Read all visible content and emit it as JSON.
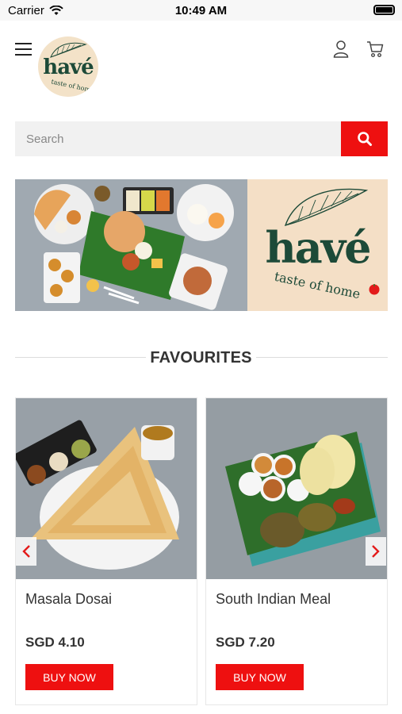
{
  "status_bar": {
    "carrier": "Carrier",
    "time": "10:49 AM"
  },
  "header": {
    "logo_text": "havé",
    "logo_tagline": "taste of home"
  },
  "search": {
    "placeholder": "Search"
  },
  "banner": {
    "brand_text": "havé",
    "tagline": "taste of home"
  },
  "favourites": {
    "title": "FAVOURITES",
    "products": [
      {
        "name": "Masala Dosai",
        "price": "SGD 4.10",
        "button_label": "BUY NOW"
      },
      {
        "name": "South Indian Meal",
        "price": "SGD 7.20",
        "button_label": "BUY NOW"
      }
    ]
  },
  "colors": {
    "accent": "#ee1010",
    "brand_green": "#1d4a38",
    "brand_beige": "#f4dfc6"
  }
}
